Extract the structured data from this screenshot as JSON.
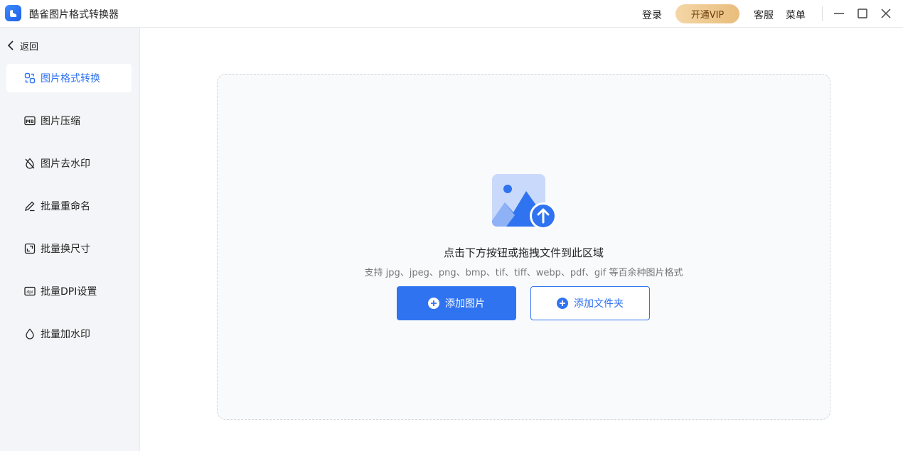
{
  "app": {
    "title": "酷雀图片格式转换器"
  },
  "topbar": {
    "login": "登录",
    "vip": "开通VIP",
    "service": "客服",
    "menu": "菜单"
  },
  "sidebar": {
    "back": "返回",
    "items": [
      {
        "label": "图片格式转换",
        "icon": "convert-icon",
        "active": true
      },
      {
        "label": "图片压缩",
        "icon": "mb-compress-icon",
        "active": false
      },
      {
        "label": "图片去水印",
        "icon": "drop-slash-icon",
        "active": false
      },
      {
        "label": "批量重命名",
        "icon": "pencil-icon",
        "active": false
      },
      {
        "label": "批量换尺寸",
        "icon": "resize-icon",
        "active": false
      },
      {
        "label": "批量DPI设置",
        "icon": "dpi-icon",
        "active": false
      },
      {
        "label": "批量加水印",
        "icon": "drop-icon",
        "active": false
      }
    ]
  },
  "dropzone": {
    "title": "点击下方按钮或拖拽文件到此区域",
    "subtitle": "支持 jpg、jpeg、png、bmp、tif、tiff、webp、pdf、gif 等百余种图片格式",
    "add_image": "添加图片",
    "add_folder": "添加文件夹"
  },
  "colors": {
    "accent": "#2f73f0",
    "vip_gold": "#e9bd7c"
  }
}
